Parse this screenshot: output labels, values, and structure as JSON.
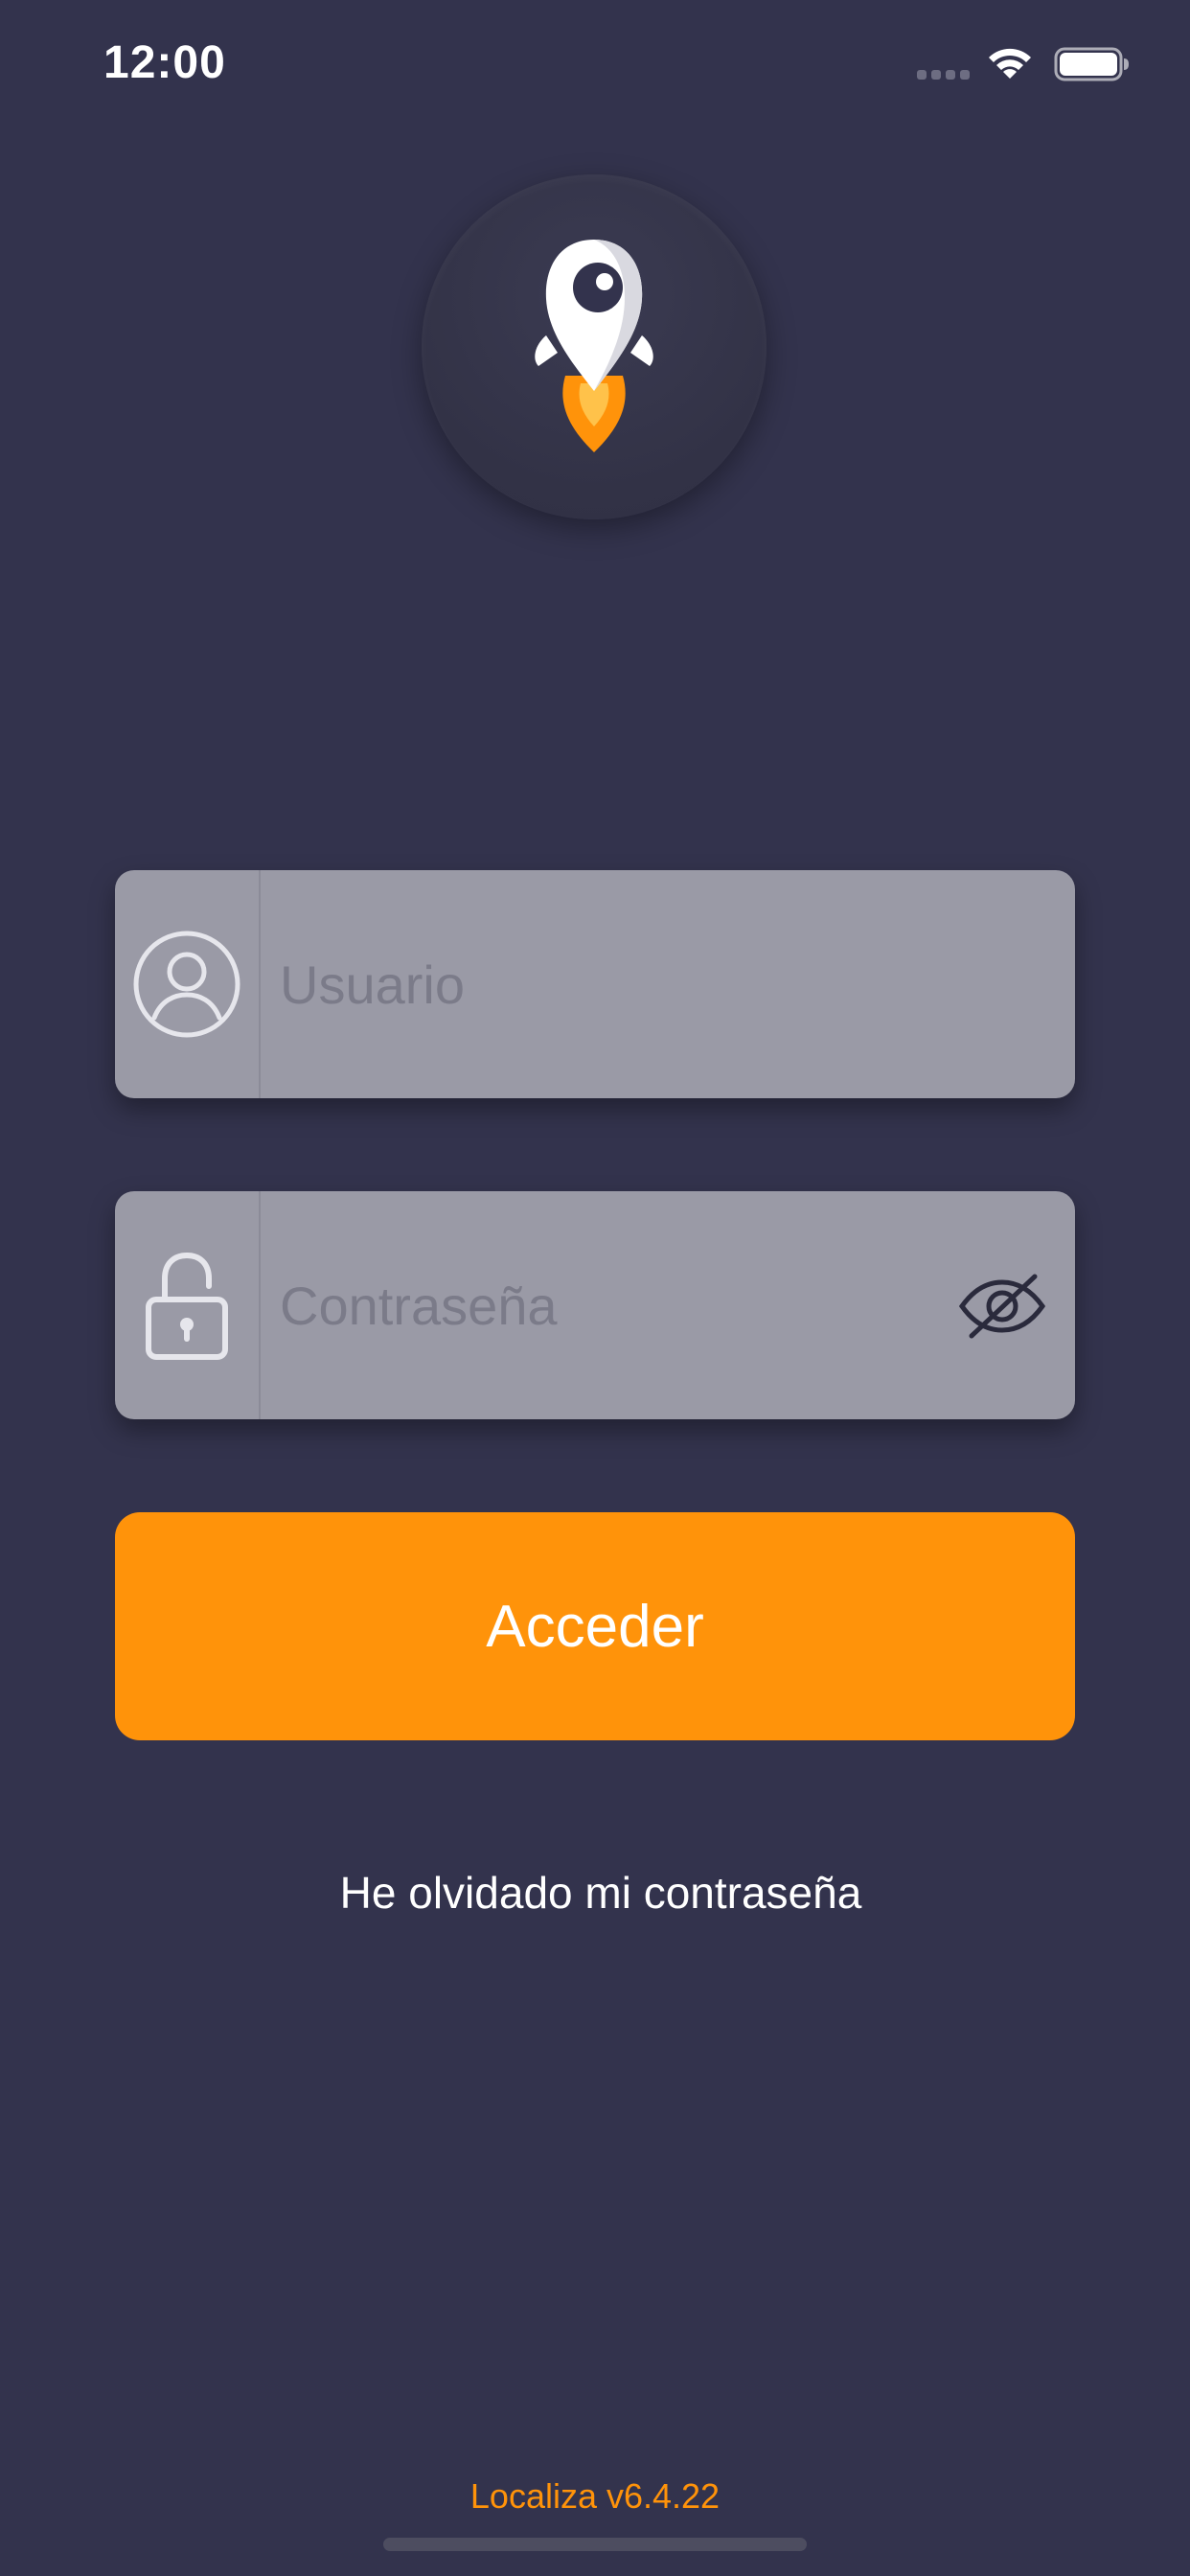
{
  "status_bar": {
    "time": "12:00"
  },
  "login": {
    "username_placeholder": "Usuario",
    "password_placeholder": "Contraseña",
    "submit_label": "Acceder",
    "forgot_password_label": "He olvidado mi contraseña"
  },
  "footer": {
    "version": "Localiza v6.4.22"
  },
  "icons": {
    "logo": "rocket-location-pin-icon",
    "username": "user-circle-icon",
    "password": "lock-icon",
    "password_toggle": "eye-off-icon",
    "signal": "cellular-signal-icon",
    "wifi": "wifi-icon",
    "battery": "battery-icon"
  },
  "colors": {
    "background": "#33334d",
    "accent": "#ff930a",
    "field": "#9a9aa6"
  }
}
